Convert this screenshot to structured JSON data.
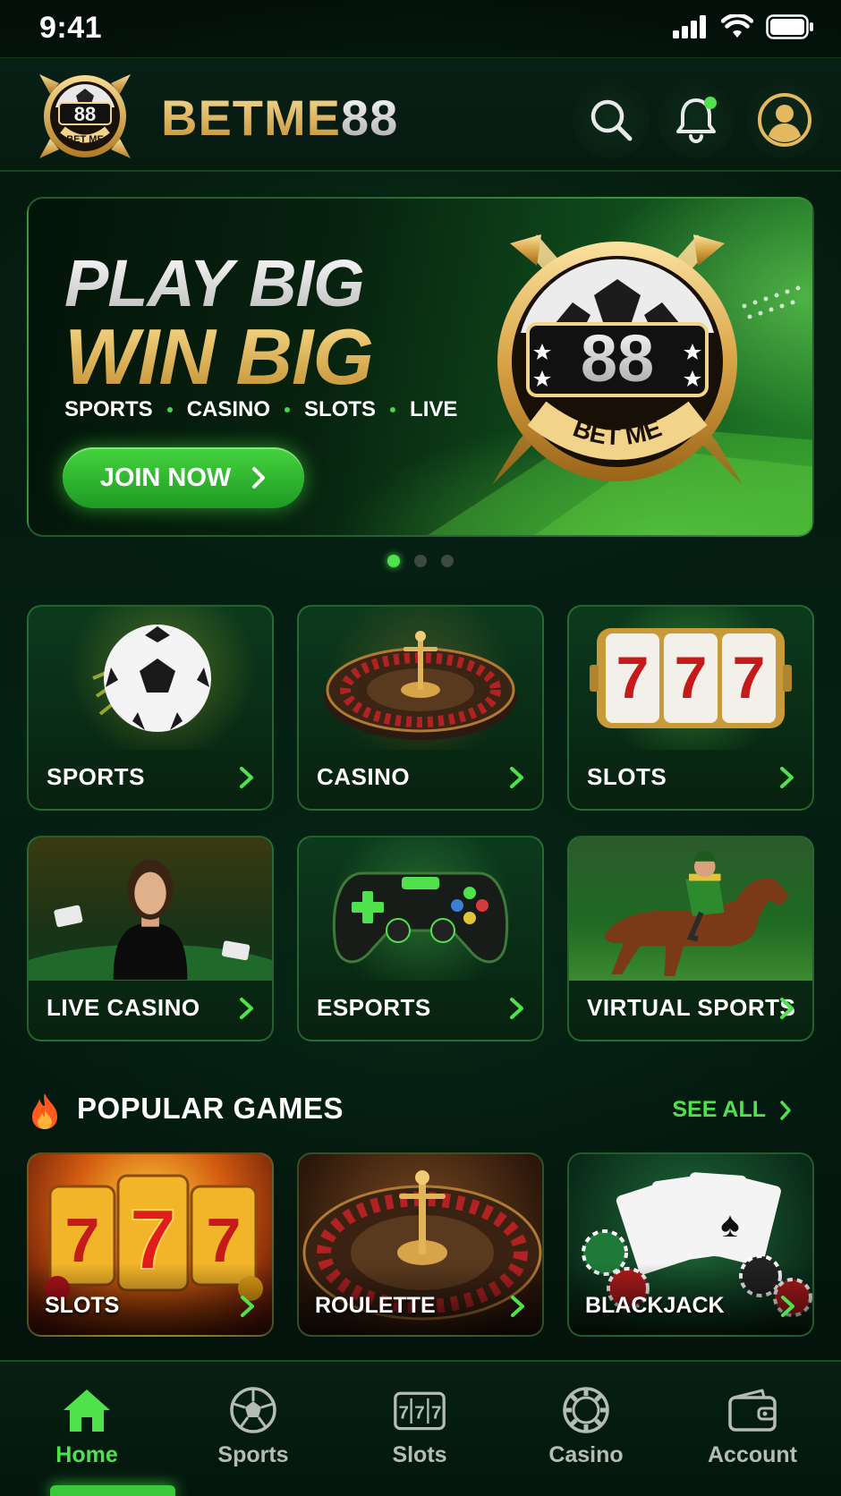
{
  "status_bar": {
    "time": "9:41"
  },
  "header": {
    "logo_text": "88",
    "logo_ribbon": "BET ME",
    "brand_part1": "BETME",
    "brand_part2": "88"
  },
  "hero": {
    "title_line1": "PLAY BIG",
    "title_line2": "WIN BIG",
    "tags": [
      "SPORTS",
      "CASINO",
      "SLOTS",
      "LIVE"
    ],
    "cta_label": "JOIN NOW",
    "emblem_number": "88",
    "emblem_ribbon": "BET ME",
    "carousel": {
      "total": 3,
      "active": 1
    }
  },
  "categories": [
    {
      "label": "SPORTS"
    },
    {
      "label": "CASINO"
    },
    {
      "label": "SLOTS"
    },
    {
      "label": "LIVE CASINO"
    },
    {
      "label": "ESPORTS"
    },
    {
      "label": "VIRTUAL SPORTS"
    }
  ],
  "popular": {
    "title": "POPULAR GAMES",
    "see_all": "SEE ALL",
    "games": [
      {
        "label": "SLOTS"
      },
      {
        "label": "ROULETTE"
      },
      {
        "label": "BLACKJACK"
      }
    ]
  },
  "tabbar": {
    "items": [
      {
        "label": "Home",
        "icon": "home-icon",
        "active": true
      },
      {
        "label": "Sports",
        "icon": "soccer-ball-icon",
        "active": false
      },
      {
        "label": "Slots",
        "icon": "slot-machine-icon",
        "active": false
      },
      {
        "label": "Casino",
        "icon": "casino-chip-icon",
        "active": false
      },
      {
        "label": "Account",
        "icon": "wallet-icon",
        "active": false
      }
    ]
  },
  "colors": {
    "accent_green": "#4fe24c",
    "gold": "#e0b25a",
    "background": "#04130b"
  }
}
